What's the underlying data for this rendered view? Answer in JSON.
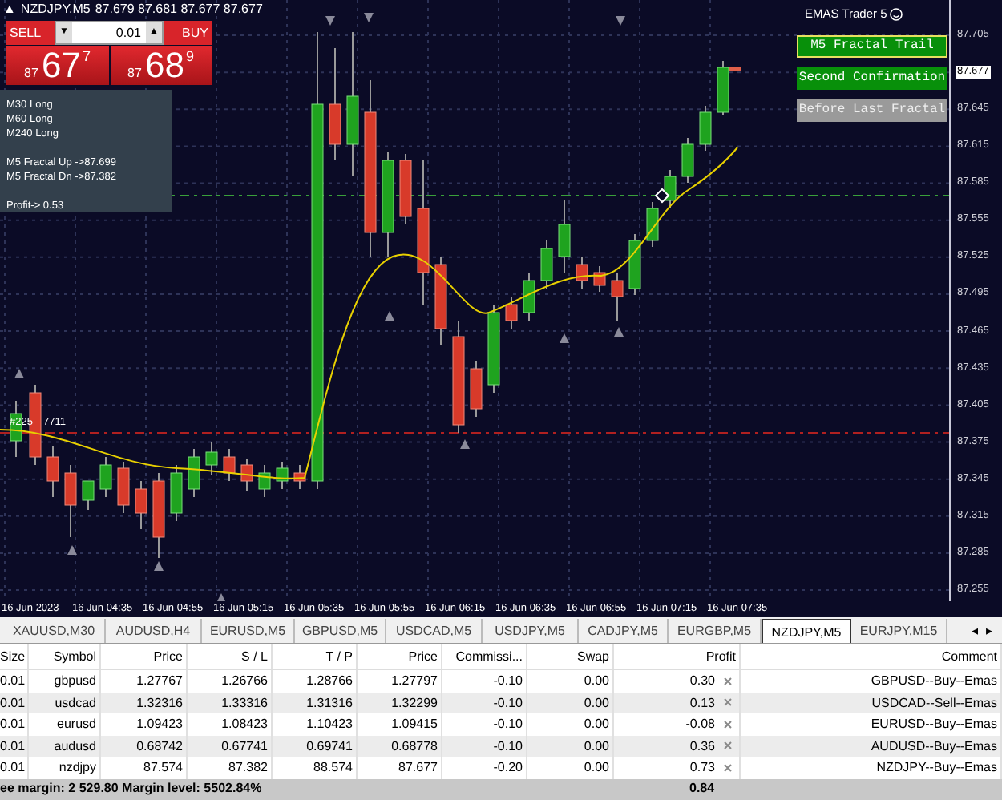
{
  "chart": {
    "title": "NZDJPY,M5",
    "title_arrow": "▲",
    "ohlc": "87.679 87.681 87.677 87.677",
    "indicator_name": "EMAS Trader 5",
    "order_tag": "#225",
    "order_ticket": "7711",
    "price_labels": [
      {
        "text": "87.705",
        "highlighted": false
      },
      {
        "text": "87.677",
        "highlighted": true
      },
      {
        "text": "87.645",
        "highlighted": false
      },
      {
        "text": "87.615",
        "highlighted": false
      },
      {
        "text": "87.585",
        "highlighted": false
      },
      {
        "text": "87.555",
        "highlighted": false
      },
      {
        "text": "87.525",
        "highlighted": false
      },
      {
        "text": "87.495",
        "highlighted": false
      },
      {
        "text": "87.465",
        "highlighted": false
      },
      {
        "text": "87.435",
        "highlighted": false
      },
      {
        "text": "87.405",
        "highlighted": false
      },
      {
        "text": "87.375",
        "highlighted": false
      },
      {
        "text": "87.345",
        "highlighted": false
      },
      {
        "text": "87.315",
        "highlighted": false
      },
      {
        "text": "87.285",
        "highlighted": false
      },
      {
        "text": "87.255",
        "highlighted": false
      }
    ],
    "time_labels": [
      "16 Jun 2023",
      "16 Jun 04:35",
      "16 Jun 04:55",
      "16 Jun 05:15",
      "16 Jun 05:35",
      "16 Jun 05:55",
      "16 Jun 06:15",
      "16 Jun 06:35",
      "16 Jun 06:55",
      "16 Jun 07:15",
      "16 Jun 07:35"
    ]
  },
  "trade_panel": {
    "sell": {
      "label": "SELL",
      "prefix": "87",
      "big": "67",
      "sup": "7"
    },
    "buy": {
      "label": "BUY",
      "prefix": "87",
      "big": "68",
      "sup": "9"
    },
    "lot": "0.01",
    "down": "▼",
    "up": "▲"
  },
  "info_panel": {
    "lines": [
      "M30 Long",
      "M60 Long",
      "M240 Long"
    ],
    "fractals": [
      "M5 Fractal Up ->87.699",
      "M5 Fractal Dn ->87.382"
    ],
    "profit": "Profit-> 0.53"
  },
  "indicator_buttons": [
    {
      "label": "M5 Fractal Trail",
      "active": true,
      "selected": true
    },
    {
      "label": "Second Confirmation",
      "active": true,
      "selected": false
    },
    {
      "label": "Before Last Fractal",
      "active": false,
      "selected": false
    }
  ],
  "tabs": [
    {
      "label": "XAUUSD,M30",
      "selected": false
    },
    {
      "label": "AUDUSD,H4",
      "selected": false
    },
    {
      "label": "EURUSD,M5",
      "selected": false
    },
    {
      "label": "GBPUSD,M5",
      "selected": false
    },
    {
      "label": "USDCAD,M5",
      "selected": false
    },
    {
      "label": "USDJPY,M5",
      "selected": false
    },
    {
      "label": "CADJPY,M5",
      "selected": false
    },
    {
      "label": "EURGBP,M5",
      "selected": false
    },
    {
      "label": "NZDJPY,M5",
      "selected": true
    },
    {
      "label": "EURJPY,M15",
      "selected": false
    }
  ],
  "tab_scroll": [
    "◂",
    "▸"
  ],
  "table": {
    "columns": [
      "Size",
      "Symbol",
      "Price",
      "S / L",
      "T / P",
      "Price",
      "Commissi...",
      "Swap",
      "Profit",
      "Comment"
    ],
    "rows": [
      [
        "0.01",
        "gbpusd",
        "1.27767",
        "1.26766",
        "1.28766",
        "1.27797",
        "-0.10",
        "0.00",
        "0.30",
        "GBPUSD--Buy--Emas"
      ],
      [
        "0.01",
        "usdcad",
        "1.32316",
        "1.33316",
        "1.31316",
        "1.32299",
        "-0.10",
        "0.00",
        "0.13",
        "USDCAD--Sell--Emas"
      ],
      [
        "0.01",
        "eurusd",
        "1.09423",
        "1.08423",
        "1.10423",
        "1.09415",
        "-0.10",
        "0.00",
        "-0.08",
        "EURUSD--Buy--Emas"
      ],
      [
        "0.01",
        "audusd",
        "0.68742",
        "0.67741",
        "0.69741",
        "0.68778",
        "-0.10",
        "0.00",
        "0.36",
        "AUDUSD--Buy--Emas"
      ],
      [
        "0.01",
        "nzdjpy",
        "87.574",
        "87.382",
        "88.574",
        "87.677",
        "-0.20",
        "0.00",
        "0.73",
        "NZDJPY--Buy--Emas"
      ]
    ],
    "footer": {
      "summary": "ee margin: 2 529.80  Margin level: 5502.84%",
      "profit": "0.84"
    }
  }
}
